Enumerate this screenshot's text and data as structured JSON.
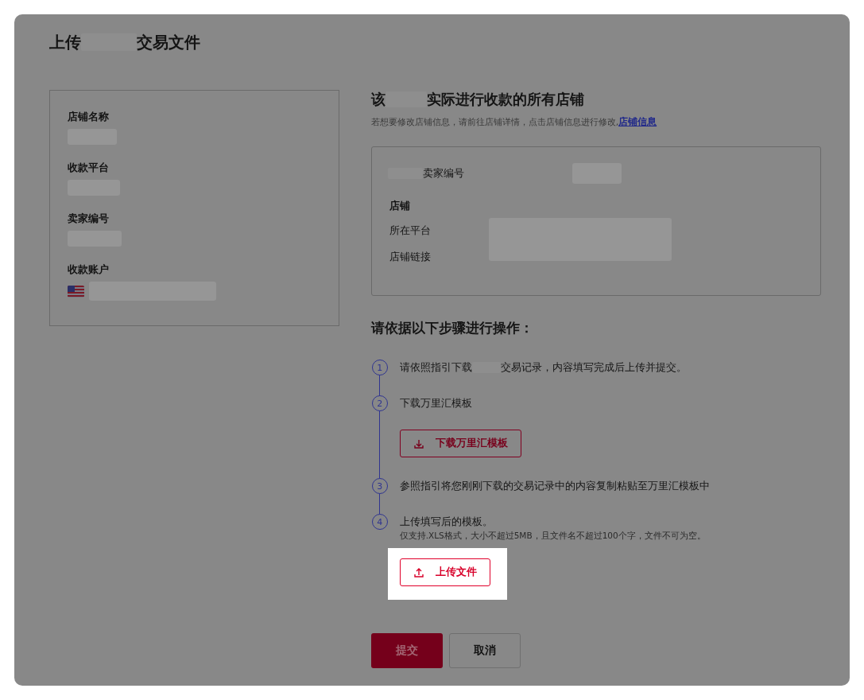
{
  "title": [
    "上传",
    "交易文件"
  ],
  "account_card": {
    "fields": [
      {
        "label": "店铺名称",
        "kind": "plain"
      },
      {
        "label": "收款平台",
        "kind": "plain"
      },
      {
        "label": "卖家编号",
        "kind": "plain"
      },
      {
        "label": "收款账户",
        "kind": "flag"
      }
    ]
  },
  "stores": {
    "heading": [
      "该",
      "实际进行收款的所有店铺"
    ],
    "hint": "若想要修改店铺信息，请前往店铺详情，点击店铺信息进行修改,",
    "link": "店铺信息",
    "seller_label": "卖家编号",
    "store_label": "店铺",
    "rows": [
      "所在平台",
      "店铺链接"
    ]
  },
  "steps_heading": "请依据以下步骤进行操作：",
  "steps": [
    {
      "number": "1",
      "text": [
        "请依照指引下载",
        "交易记录，内容填写完成后上传并提交。"
      ]
    },
    {
      "number": "2",
      "text": [
        "下载万里汇模板"
      ],
      "button": {
        "label": "下载万里汇模板",
        "kind": "download",
        "highlighted": false
      }
    },
    {
      "number": "3",
      "text": [
        "参照指引将您刚刚下载的交易记录中的内容复制粘贴至万里汇模板中"
      ]
    },
    {
      "number": "4",
      "text": [
        "上传填写后的模板。"
      ],
      "note": "仅支持.XLS格式，大小不超过5MB，且文件名不超过100个字，文件不可为空。",
      "button": {
        "label": "上传文件",
        "kind": "upload",
        "highlighted": true
      }
    }
  ],
  "actions": [
    {
      "label": "提交",
      "kind": "primary"
    },
    {
      "label": "取消",
      "kind": "secondary"
    }
  ]
}
